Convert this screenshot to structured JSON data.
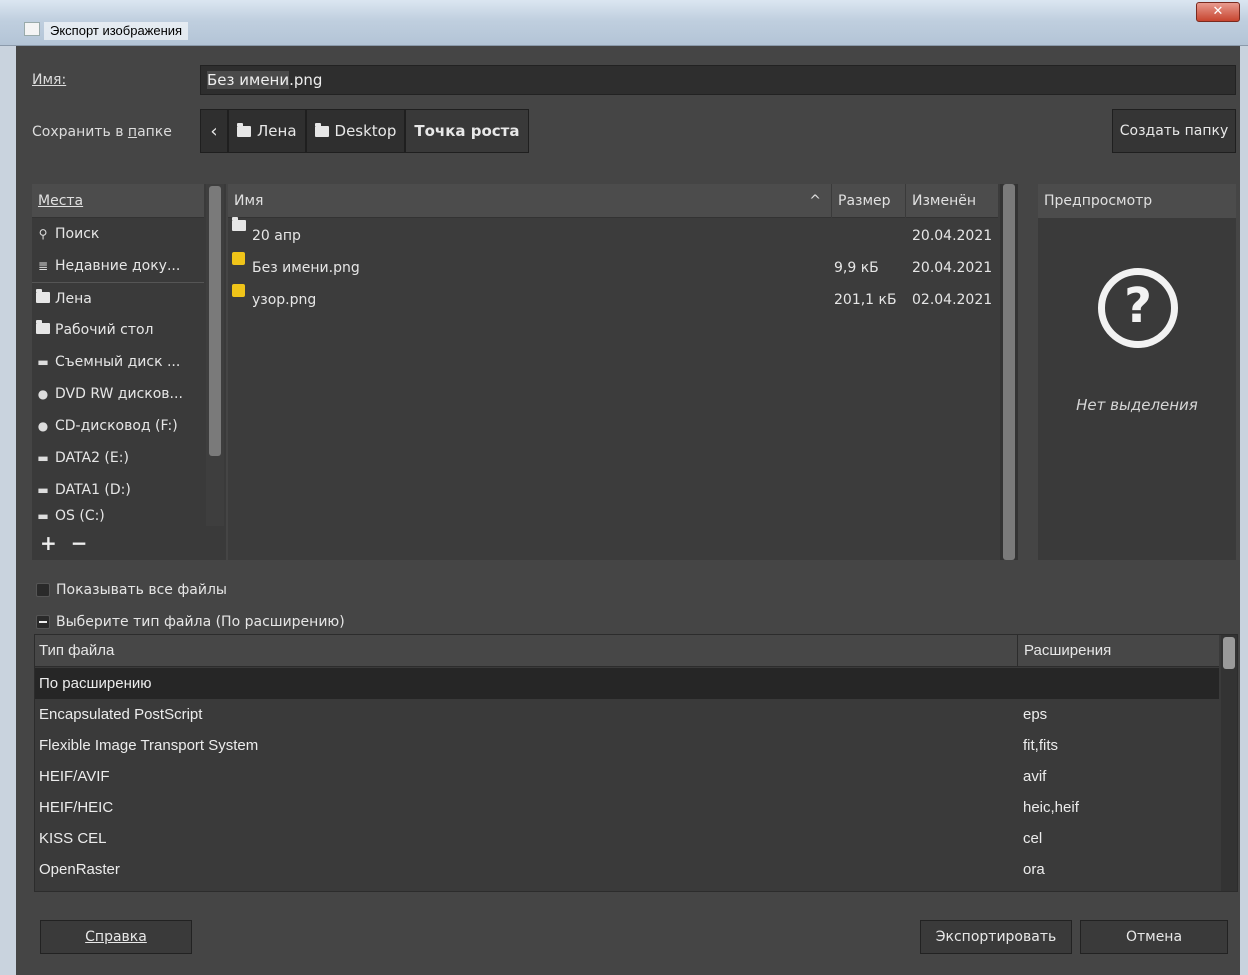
{
  "window": {
    "title": "Экспорт изображения",
    "close_glyph": "✕"
  },
  "name_row": {
    "label": "Имя:",
    "value_selected": "Без имени",
    "value_ext": ".png"
  },
  "folder_row": {
    "label": "Сохранить в папке",
    "crumbs": [
      "Лена",
      "Desktop",
      "Точка роста"
    ],
    "create_folder": "Создать папку"
  },
  "places": {
    "header": "Места",
    "items": [
      {
        "icon": "search-icon",
        "label": "Поиск"
      },
      {
        "icon": "recent-icon",
        "label": "Недавние доку..."
      },
      {
        "icon": "folder-icon",
        "label": "Лена"
      },
      {
        "icon": "folder-icon",
        "label": "Рабочий стол"
      },
      {
        "icon": "drive-icon",
        "label": "Съемный диск ..."
      },
      {
        "icon": "optical-drive-icon",
        "label": "DVD RW дисков..."
      },
      {
        "icon": "optical-drive-icon",
        "label": "CD-дисковод (F:)"
      },
      {
        "icon": "drive-icon",
        "label": "DATA2 (E:)"
      },
      {
        "icon": "drive-icon",
        "label": "DATA1 (D:)"
      },
      {
        "icon": "drive-icon",
        "label": "OS (C:)"
      }
    ],
    "add": "+",
    "remove": "−"
  },
  "files": {
    "columns": {
      "name": "Имя",
      "size": "Размер",
      "modified": "Изменён"
    },
    "sort_arrow": "^",
    "rows": [
      {
        "icon": "folder-icon",
        "name": "20 апр",
        "size": "",
        "modified": "20.04.2021"
      },
      {
        "icon": "png-file-icon",
        "name": "Без имени.png",
        "size": "9,9 кБ",
        "modified": "20.04.2021"
      },
      {
        "icon": "png-file-icon",
        "name": "узор.png",
        "size": "201,1 кБ",
        "modified": "02.04.2021"
      }
    ]
  },
  "preview": {
    "header": "Предпросмотр",
    "glyph": "?",
    "empty": "Нет выделения"
  },
  "options": {
    "show_all": "Показывать все файлы",
    "file_type_toggle": "Выберите тип файла (По расширению)"
  },
  "types": {
    "col_type": "Тип файла",
    "col_ext": "Расширения",
    "rows": [
      {
        "name": "По расширению",
        "ext": ""
      },
      {
        "name": "Encapsulated PostScript",
        "ext": "eps"
      },
      {
        "name": "Flexible Image Transport System",
        "ext": "fit,fits"
      },
      {
        "name": "HEIF/AVIF",
        "ext": "avif"
      },
      {
        "name": "HEIF/HEIC",
        "ext": "heic,heif"
      },
      {
        "name": "KISS CEL",
        "ext": "cel"
      },
      {
        "name": "OpenRaster",
        "ext": "ora"
      }
    ]
  },
  "buttons": {
    "help": "Справка",
    "export": "Экспортировать",
    "cancel": "Отмена"
  }
}
